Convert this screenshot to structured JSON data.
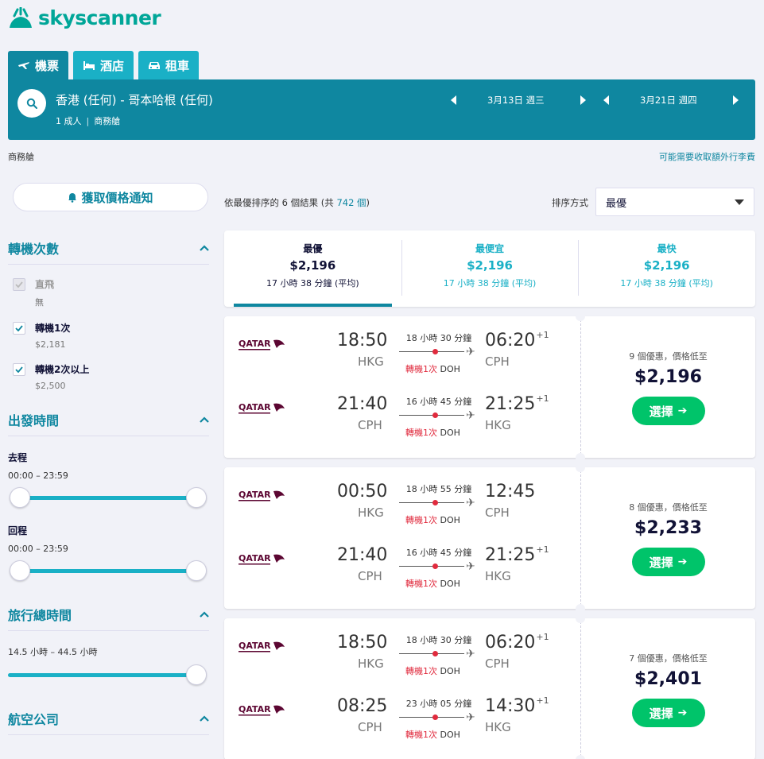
{
  "brand": {
    "name": "skyscanner"
  },
  "tabs": [
    {
      "label": "機票",
      "icon": "plane-icon"
    },
    {
      "label": "酒店",
      "icon": "bed-icon"
    },
    {
      "label": "租車",
      "icon": "car-icon"
    }
  ],
  "search": {
    "route": "香港 (任何) - 哥本哈根 (任何)",
    "travellers": "1 成人",
    "cabin": "商務艙",
    "depart_date": "3月13日 週三",
    "return_date": "3月21日 週四"
  },
  "info": {
    "cabin": "商務艙",
    "bag_fees": "可能需要收取額外行李費"
  },
  "sidebar": {
    "alert_label": "獲取價格通知",
    "stops": {
      "title": "轉機次數",
      "options": [
        {
          "label": "直飛",
          "sub": "無",
          "checked": false,
          "disabled": true
        },
        {
          "label": "轉機1次",
          "sub": "$2,181",
          "checked": true,
          "disabled": false
        },
        {
          "label": "轉機2次以上",
          "sub": "$2,500",
          "checked": true,
          "disabled": false
        }
      ]
    },
    "times": {
      "title": "出發時間",
      "outbound_label": "去程",
      "outbound_range": "00:00 – 23:59",
      "return_label": "回程",
      "return_range": "00:00 – 23:59"
    },
    "duration": {
      "title": "旅行總時間",
      "range": "14.5 小時 – 44.5 小時"
    },
    "airlines": {
      "title": "航空公司"
    }
  },
  "results": {
    "prefix": "依最優排序的 6 個結果 (共 ",
    "total": "742 個",
    "suffix": ")",
    "sort_label": "排序方式",
    "sort_value": "最優"
  },
  "sort_tabs": [
    {
      "title": "最優",
      "price": "$2,196",
      "duration": "17 小時 38 分鐘 (平均)"
    },
    {
      "title": "最便宜",
      "price": "$2,196",
      "duration": "17 小時 38 分鐘 (平均)"
    },
    {
      "title": "最快",
      "price": "$2,196",
      "duration": "17 小時 38 分鐘 (平均)"
    }
  ],
  "airline_logo_text": "QATAR",
  "cards": [
    {
      "deals": "9 個優惠，價格低至",
      "price": "$2,196",
      "select": "選擇",
      "legs": [
        {
          "dep_time": "18:50",
          "dep_ap": "HKG",
          "duration": "18 小時 30 分鐘",
          "stops": "轉機1次",
          "via": "DOH",
          "arr_time": "06:20",
          "plus": "+1",
          "arr_ap": "CPH"
        },
        {
          "dep_time": "21:40",
          "dep_ap": "CPH",
          "duration": "16 小時 45 分鐘",
          "stops": "轉機1次",
          "via": "DOH",
          "arr_time": "21:25",
          "plus": "+1",
          "arr_ap": "HKG"
        }
      ]
    },
    {
      "deals": "8 個優惠，價格低至",
      "price": "$2,233",
      "select": "選擇",
      "legs": [
        {
          "dep_time": "00:50",
          "dep_ap": "HKG",
          "duration": "18 小時 55 分鐘",
          "stops": "轉機1次",
          "via": "DOH",
          "arr_time": "12:45",
          "plus": "",
          "arr_ap": "CPH"
        },
        {
          "dep_time": "21:40",
          "dep_ap": "CPH",
          "duration": "16 小時 45 分鐘",
          "stops": "轉機1次",
          "via": "DOH",
          "arr_time": "21:25",
          "plus": "+1",
          "arr_ap": "HKG"
        }
      ]
    },
    {
      "deals": "7 個優惠，價格低至",
      "price": "$2,401",
      "select": "選擇",
      "legs": [
        {
          "dep_time": "18:50",
          "dep_ap": "HKG",
          "duration": "18 小時 30 分鐘",
          "stops": "轉機1次",
          "via": "DOH",
          "arr_time": "06:20",
          "plus": "+1",
          "arr_ap": "CPH"
        },
        {
          "dep_time": "08:25",
          "dep_ap": "CPH",
          "duration": "23 小時 05 分鐘",
          "stops": "轉機1次",
          "via": "DOH",
          "arr_time": "14:30",
          "plus": "+1",
          "arr_ap": "HKG"
        }
      ]
    }
  ],
  "colors": {
    "brand_teal": "#0f87a0",
    "accent": "#1ab0c6",
    "green": "#00c46a",
    "stop_red": "#e02a3d"
  }
}
